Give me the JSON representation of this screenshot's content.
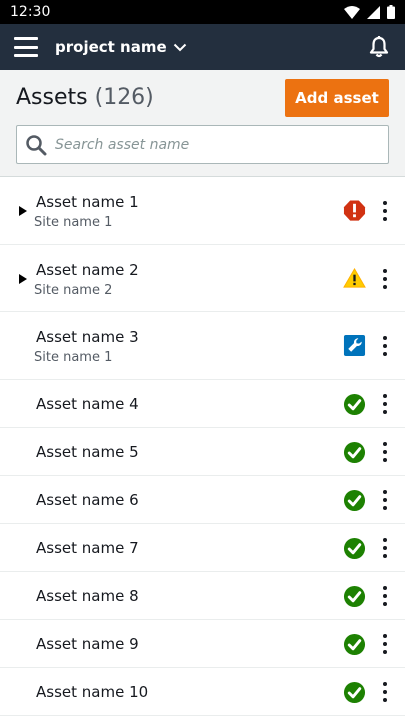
{
  "status_bar": {
    "time": "12:30"
  },
  "top_bar": {
    "project_label": "project name"
  },
  "header": {
    "title": "Assets",
    "count": "(126)",
    "add_button": "Add asset"
  },
  "search": {
    "placeholder": "Search asset name",
    "value": ""
  },
  "colors": {
    "top_bar": "#232f3e",
    "accent": "#ec7211",
    "error": "#d13212",
    "warning": "#ff9900",
    "info": "#0073bb",
    "success": "#1d8102"
  },
  "assets": [
    {
      "name": "Asset name 1",
      "site": "Site name 1",
      "expandable": true,
      "status": "error"
    },
    {
      "name": "Asset name 2",
      "site": "Site name 2",
      "expandable": true,
      "status": "warning"
    },
    {
      "name": "Asset name 3",
      "site": "Site name 1",
      "expandable": false,
      "status": "maintenance"
    },
    {
      "name": "Asset name 4",
      "site": "",
      "expandable": false,
      "status": "ok"
    },
    {
      "name": "Asset name 5",
      "site": "",
      "expandable": false,
      "status": "ok"
    },
    {
      "name": "Asset name 6",
      "site": "",
      "expandable": false,
      "status": "ok"
    },
    {
      "name": "Asset name 7",
      "site": "",
      "expandable": false,
      "status": "ok"
    },
    {
      "name": "Asset name 8",
      "site": "",
      "expandable": false,
      "status": "ok"
    },
    {
      "name": "Asset name 9",
      "site": "",
      "expandable": false,
      "status": "ok"
    },
    {
      "name": "Asset name 10",
      "site": "",
      "expandable": false,
      "status": "ok"
    }
  ]
}
